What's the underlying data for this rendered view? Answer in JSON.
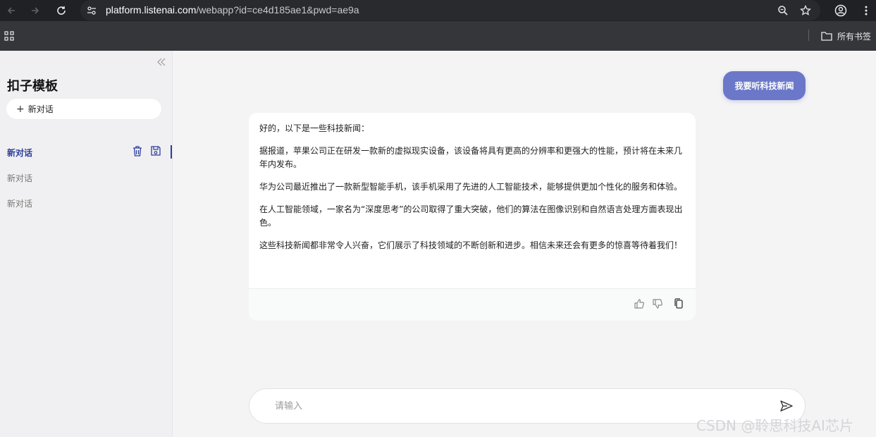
{
  "browser": {
    "url_host": "platform.listenai.com",
    "url_path": "/webapp?id=ce4d185ae1&pwd=ae9a",
    "bookmarks_label": "所有书签"
  },
  "sidebar": {
    "title": "扣子模板",
    "new_chat_label": "新对话",
    "conversations": [
      {
        "label": "新对话"
      },
      {
        "label": "新对话"
      },
      {
        "label": "新对话"
      }
    ]
  },
  "chat": {
    "user_message": "我要听科技新闻",
    "bot_paragraphs": [
      "好的，以下是一些科技新闻：",
      "据报道，苹果公司正在研发一款新的虚拟现实设备，该设备将具有更高的分辨率和更强大的性能，预计将在未来几年内发布。",
      "华为公司最近推出了一款新型智能手机，该手机采用了先进的人工智能技术，能够提供更加个性化的服务和体验。",
      "在人工智能领域，一家名为“深度思考”的公司取得了重大突破，他们的算法在图像识别和自然语言处理方面表现出色。",
      "这些科技新闻都非常令人兴奋，它们展示了科技领域的不断创新和进步。相信未来还会有更多的惊喜等待着我们！"
    ],
    "input_placeholder": "请输入"
  },
  "watermark": "CSDN @聆思科技AI芯片",
  "colors": {
    "accent": "#2c3e9b",
    "user_bubble": "#6b78c9"
  }
}
